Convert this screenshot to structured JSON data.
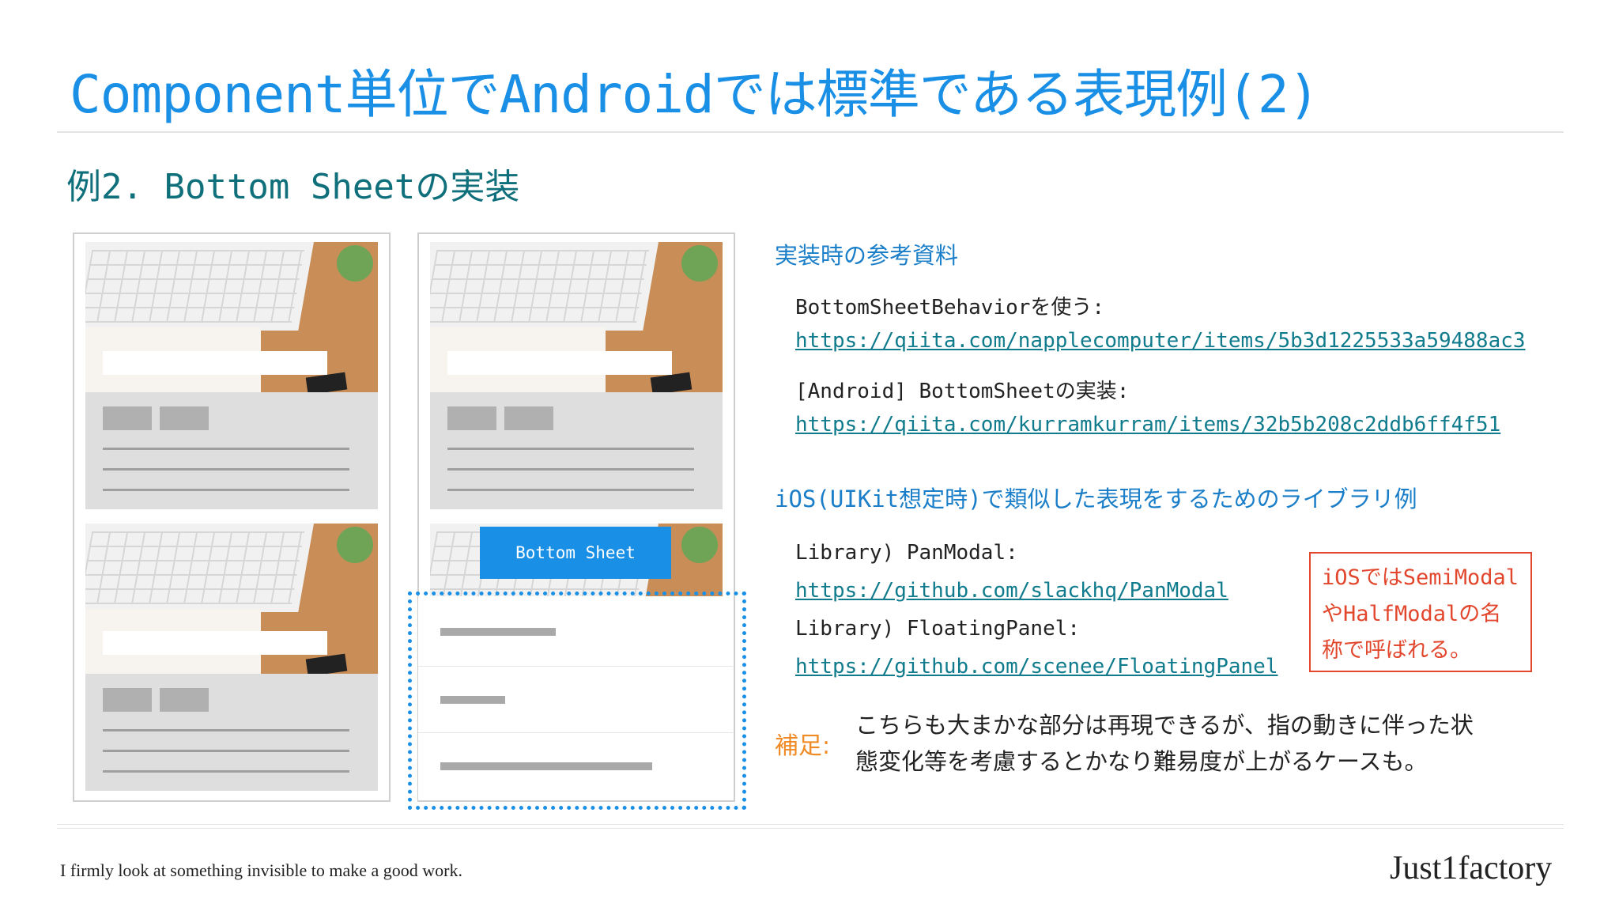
{
  "title": "Component単位でAndroidでは標準である表現例(2)",
  "subtitle": "例2. Bottom Sheetの実装",
  "mockup": {
    "bottom_sheet_label": "Bottom Sheet"
  },
  "references": {
    "heading": "実装時の参考資料",
    "items": [
      {
        "label": "BottomSheetBehaviorを使う:",
        "url": "https://qiita.com/napplecomputer/items/5b3d1225533a59488ac3"
      },
      {
        "label": "[Android] BottomSheetの実装:",
        "url": "https://qiita.com/kurramkurram/items/32b5b208c2ddb6ff4f51"
      }
    ]
  },
  "ios": {
    "heading": "iOS(UIKit想定時)で類似した表現をするためのライブラリ例",
    "items": [
      {
        "label": "Library) PanModal:",
        "url": "https://github.com/slackhq/PanModal"
      },
      {
        "label": "Library) FloatingPanel:",
        "url": "https://github.com/scenee/FloatingPanel"
      }
    ],
    "note_lines": [
      "iOSではSemiModal",
      "やHalfModalの名",
      "称で呼ばれる。"
    ]
  },
  "supplement": {
    "label": "補足:",
    "lines": [
      "こちらも大まかな部分は再現できるが、指の動きに伴った状",
      "態変化等を考慮するとかなり難易度が上がるケースも。"
    ]
  },
  "footer": {
    "tagline": "I firmly look at something invisible to make a good work.",
    "brand": "Just1factory"
  },
  "colors": {
    "title_blue": "#1a8fe6",
    "subtitle_teal": "#0f6f7a",
    "link_teal": "#0f7b8c",
    "note_red": "#e2472d",
    "supplement_orange": "#f08a24"
  }
}
